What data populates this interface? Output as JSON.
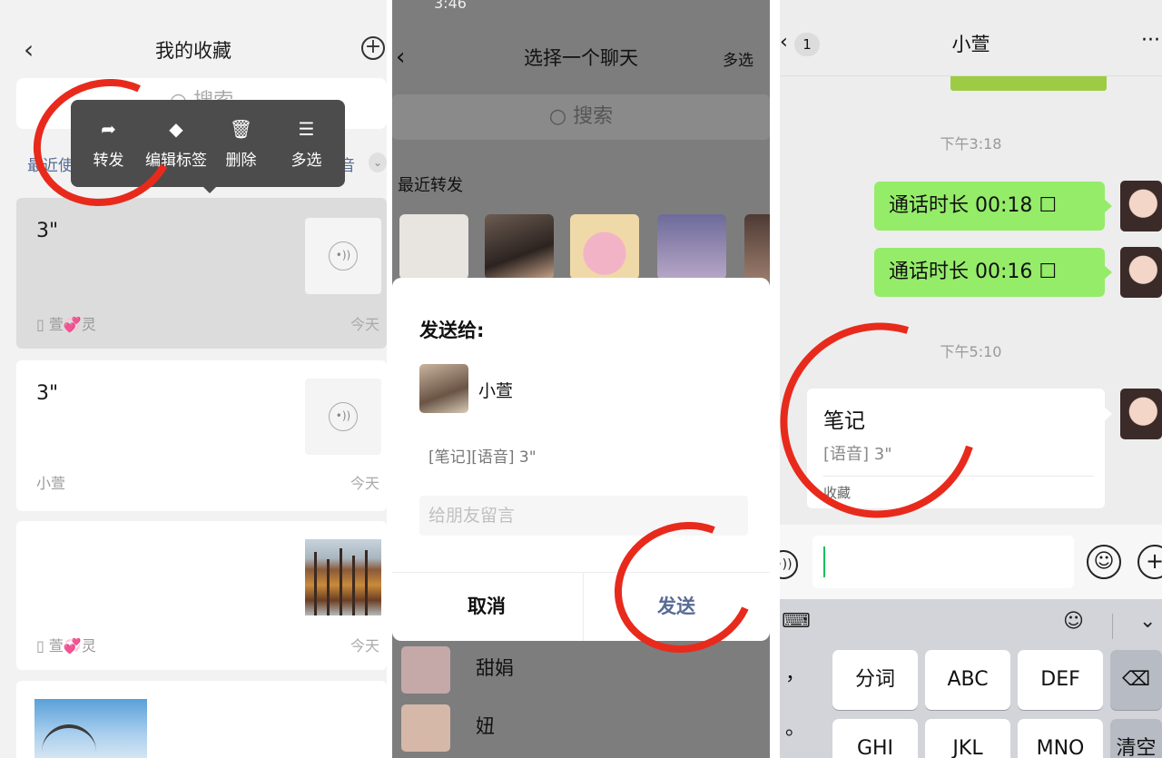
{
  "panel1": {
    "title": "我的收藏",
    "search": "搜索",
    "filter_left": "最近使",
    "filter_right": "音",
    "menu": {
      "forward": "转发",
      "edit_tag": "编辑标签",
      "delete": "删除",
      "multi": "多选"
    },
    "cards": [
      {
        "title": "3\"",
        "source": "萱💞灵",
        "date": "今天"
      },
      {
        "title": "3\"",
        "source": "小萱",
        "date": "今天"
      },
      {
        "title": "",
        "source": "萱💞灵",
        "date": "今天"
      }
    ]
  },
  "panel2": {
    "status": "3:46",
    "title": "选择一个聊天",
    "multi": "多选",
    "search": "搜索",
    "recent": "最近转发",
    "dialog": {
      "send_to": "发送给:",
      "name": "小萱",
      "message": "[笔记][语音] 3\"",
      "placeholder": "给朋友留言",
      "cancel": "取消",
      "send": "发送"
    },
    "contacts": [
      "甜娟",
      "妞"
    ]
  },
  "panel3": {
    "badge": "1",
    "title": "小萱",
    "more": "···",
    "time1": "下午3:18",
    "bubbles": [
      "通话时长 00:18 ☐",
      "通话时长 00:16 ☐"
    ],
    "time2": "下午5:10",
    "note": {
      "title": "笔记",
      "sub": "[语音] 3\"",
      "source": "收藏"
    },
    "keyboard": {
      "row1": [
        "分词",
        "ABC",
        "DEF"
      ],
      "row2": [
        "GHI",
        "JKL",
        "MNO"
      ],
      "clear": "清空",
      "punct1": "，",
      "punct2": "。"
    }
  }
}
